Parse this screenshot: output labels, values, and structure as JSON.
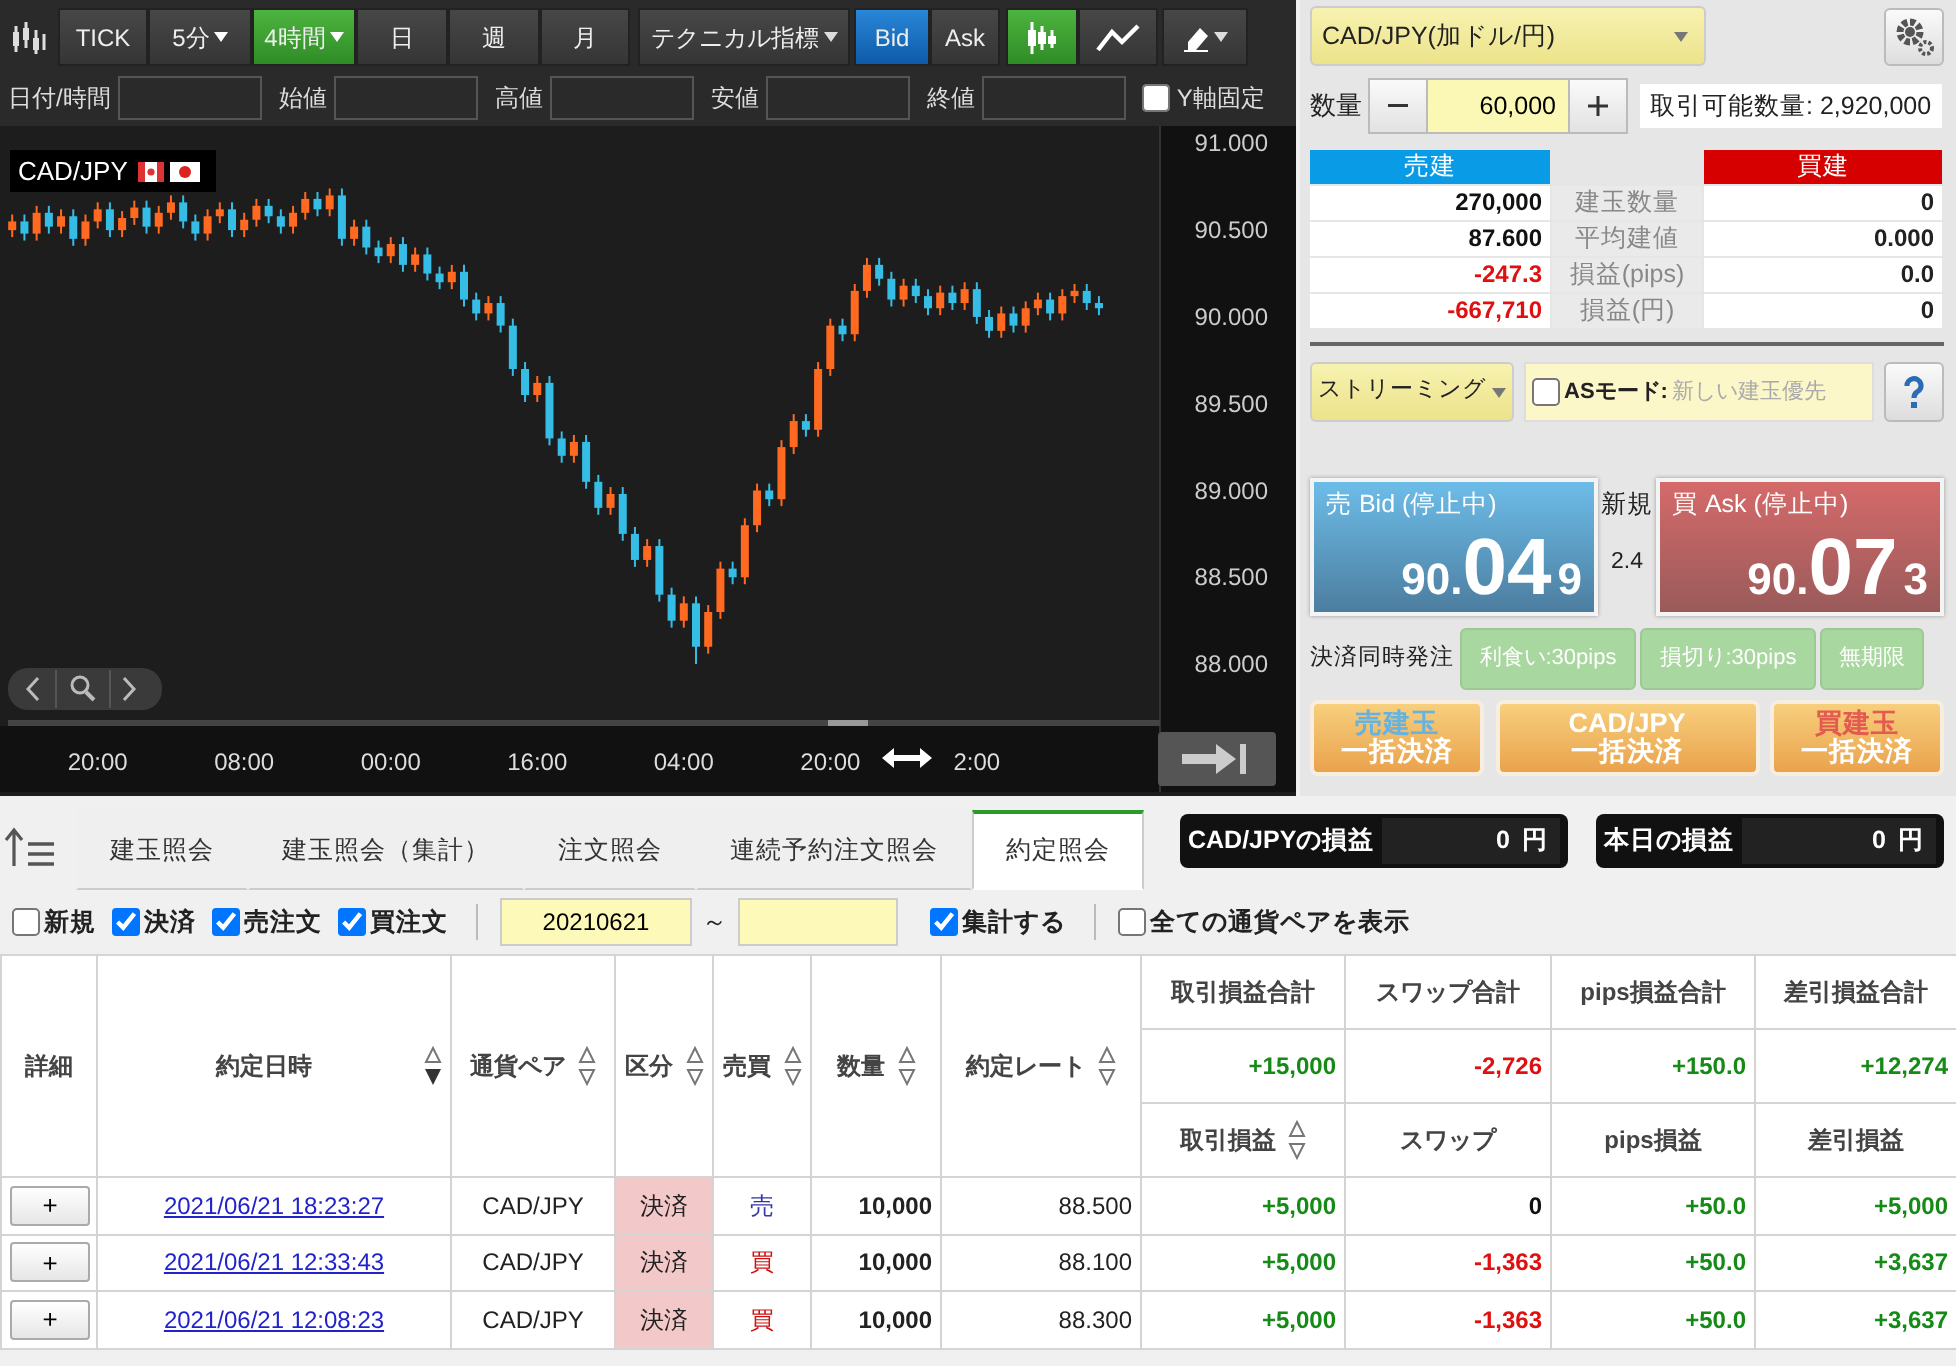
{
  "chart_toolbar": {
    "timeframes": [
      {
        "label": "TICK",
        "dropdown": false,
        "selected": false
      },
      {
        "label": "5分",
        "dropdown": true,
        "selected": false
      },
      {
        "label": "4時間",
        "dropdown": true,
        "selected": true
      },
      {
        "label": "日",
        "dropdown": false,
        "selected": false
      },
      {
        "label": "週",
        "dropdown": false,
        "selected": false
      },
      {
        "label": "月",
        "dropdown": false,
        "selected": false
      }
    ],
    "indicator_menu": "テクニカル指標",
    "price_sides": [
      {
        "label": "Bid",
        "selected": true
      },
      {
        "label": "Ask",
        "selected": false
      }
    ],
    "chart_types": [
      {
        "kind": "candle",
        "selected": true
      },
      {
        "kind": "line",
        "selected": false
      }
    ]
  },
  "ohlc_fields": [
    {
      "label": "日付/時間"
    },
    {
      "label": "始値"
    },
    {
      "label": "高値"
    },
    {
      "label": "安値"
    },
    {
      "label": "終値"
    }
  ],
  "y_axis_lock": {
    "label": "Y軸固定",
    "checked": false
  },
  "chart": {
    "symbol": "CAD/JPY",
    "chart_data": {
      "type": "candlestick",
      "ylim": [
        87.24,
        91.1
      ],
      "yticks": [
        {
          "value": 91,
          "label": "91.000"
        },
        {
          "value": 90.5,
          "label": "90.500"
        },
        {
          "value": 90,
          "label": "90.000"
        },
        {
          "value": 89.5,
          "label": "89.500"
        },
        {
          "value": 89,
          "label": "89.000"
        },
        {
          "value": 88.5,
          "label": "88.500"
        },
        {
          "value": 88,
          "label": "88.000"
        }
      ],
      "categories": [
        null,
        null,
        null,
        null,
        null,
        null,
        null,
        "20:00",
        null,
        null,
        null,
        null,
        null,
        null,
        null,
        null,
        null,
        null,
        null,
        "08:00",
        null,
        null,
        null,
        null,
        null,
        null,
        null,
        null,
        null,
        null,
        null,
        "00:00",
        null,
        null,
        null,
        null,
        null,
        null,
        null,
        null,
        null,
        null,
        null,
        "16:00",
        null,
        null,
        null,
        null,
        null,
        null,
        null,
        null,
        null,
        null,
        null,
        "04:00",
        null,
        null,
        null,
        null,
        null,
        null,
        null,
        null,
        null,
        null,
        null,
        "20:00",
        null,
        null,
        null,
        null,
        null,
        null,
        null,
        null,
        null,
        null,
        null,
        "2:00",
        null,
        null,
        null,
        null,
        null,
        null,
        null,
        null,
        null,
        null
      ],
      "ohlc": [
        [
          90.5,
          90.59,
          90.46,
          90.55
        ],
        [
          90.55,
          90.59,
          90.44,
          90.48
        ],
        [
          90.48,
          90.64,
          90.44,
          90.6
        ],
        [
          90.6,
          90.64,
          90.48,
          90.52
        ],
        [
          90.52,
          90.62,
          90.48,
          90.58
        ],
        [
          90.58,
          90.62,
          90.41,
          90.45
        ],
        [
          90.45,
          90.59,
          90.41,
          90.55
        ],
        [
          90.55,
          90.66,
          90.51,
          90.62
        ],
        [
          90.62,
          90.66,
          90.46,
          90.5
        ],
        [
          90.5,
          90.61,
          90.46,
          90.57
        ],
        [
          90.57,
          90.67,
          90.53,
          90.63
        ],
        [
          90.63,
          90.67,
          90.48,
          90.52
        ],
        [
          90.52,
          90.64,
          90.48,
          90.6
        ],
        [
          90.6,
          90.7,
          90.56,
          90.66
        ],
        [
          90.66,
          90.7,
          90.51,
          90.55
        ],
        [
          90.55,
          90.59,
          90.44,
          90.48
        ],
        [
          90.48,
          90.62,
          90.44,
          90.58
        ],
        [
          90.58,
          90.66,
          90.54,
          90.62
        ],
        [
          90.62,
          90.66,
          90.46,
          90.5
        ],
        [
          90.5,
          90.6,
          90.46,
          90.56
        ],
        [
          90.56,
          90.68,
          90.52,
          90.64
        ],
        [
          90.64,
          90.68,
          90.54,
          90.58
        ],
        [
          90.58,
          90.62,
          90.48,
          90.52
        ],
        [
          90.52,
          90.64,
          90.48,
          90.6
        ],
        [
          90.6,
          90.72,
          90.56,
          90.68
        ],
        [
          90.68,
          90.72,
          90.58,
          90.62
        ],
        [
          90.62,
          90.74,
          90.58,
          90.7
        ],
        [
          90.7,
          90.74,
          90.41,
          90.45
        ],
        [
          90.45,
          90.56,
          90.41,
          90.52
        ],
        [
          90.52,
          90.56,
          90.36,
          90.4
        ],
        [
          90.4,
          90.44,
          90.31,
          90.35
        ],
        [
          90.35,
          90.46,
          90.31,
          90.42
        ],
        [
          90.42,
          90.46,
          90.26,
          90.3
        ],
        [
          90.3,
          90.4,
          90.26,
          90.36
        ],
        [
          90.36,
          90.4,
          90.21,
          90.25
        ],
        [
          90.25,
          90.29,
          90.16,
          90.2
        ],
        [
          90.2,
          90.3,
          90.16,
          90.26
        ],
        [
          90.26,
          90.3,
          90.06,
          90.1
        ],
        [
          90.1,
          90.14,
          89.98,
          90.02
        ],
        [
          90.02,
          90.12,
          89.98,
          90.08
        ],
        [
          90.08,
          90.12,
          89.91,
          89.95
        ],
        [
          89.95,
          89.99,
          89.66,
          89.7
        ],
        [
          89.7,
          89.74,
          89.51,
          89.55
        ],
        [
          89.55,
          89.66,
          89.51,
          89.62
        ],
        [
          89.62,
          89.66,
          89.26,
          89.3
        ],
        [
          89.3,
          89.34,
          89.16,
          89.2
        ],
        [
          89.2,
          89.32,
          89.16,
          89.28
        ],
        [
          89.28,
          89.32,
          89.01,
          89.05
        ],
        [
          89.05,
          89.09,
          88.86,
          88.9
        ],
        [
          88.9,
          89.02,
          88.86,
          88.98
        ],
        [
          88.98,
          89.02,
          88.71,
          88.75
        ],
        [
          88.75,
          88.79,
          88.56,
          88.6
        ],
        [
          88.6,
          88.72,
          88.56,
          88.68
        ],
        [
          88.68,
          88.72,
          88.36,
          88.4
        ],
        [
          88.4,
          88.44,
          88.21,
          88.25
        ],
        [
          88.25,
          88.39,
          88.21,
          88.35
        ],
        [
          88.35,
          88.39,
          88.0,
          88.1
        ],
        [
          88.1,
          88.34,
          88.06,
          88.3
        ],
        [
          88.3,
          88.59,
          88.26,
          88.55
        ],
        [
          88.55,
          88.59,
          88.46,
          88.5
        ],
        [
          88.5,
          88.84,
          88.46,
          88.8
        ],
        [
          88.8,
          89.04,
          88.76,
          89.0
        ],
        [
          89.0,
          89.04,
          88.91,
          88.95
        ],
        [
          88.95,
          89.29,
          88.91,
          89.25
        ],
        [
          89.25,
          89.44,
          89.21,
          89.4
        ],
        [
          89.4,
          89.44,
          89.31,
          89.35
        ],
        [
          89.35,
          89.74,
          89.31,
          89.7
        ],
        [
          89.7,
          89.99,
          89.66,
          89.95
        ],
        [
          89.95,
          89.99,
          89.86,
          89.9
        ],
        [
          89.9,
          90.19,
          89.86,
          90.15
        ],
        [
          90.15,
          90.34,
          90.11,
          90.3
        ],
        [
          90.3,
          90.34,
          90.18,
          90.22
        ],
        [
          90.22,
          90.26,
          90.06,
          90.1
        ],
        [
          90.1,
          90.22,
          90.06,
          90.18
        ],
        [
          90.18,
          90.22,
          90.08,
          90.12
        ],
        [
          90.12,
          90.16,
          90.01,
          90.05
        ],
        [
          90.05,
          90.18,
          90.01,
          90.14
        ],
        [
          90.14,
          90.18,
          90.04,
          90.08
        ],
        [
          90.08,
          90.2,
          90.04,
          90.16
        ],
        [
          90.16,
          90.2,
          89.96,
          90.0
        ],
        [
          90.0,
          90.04,
          89.88,
          89.92
        ],
        [
          89.92,
          90.06,
          89.88,
          90.02
        ],
        [
          90.02,
          90.06,
          89.91,
          89.95
        ],
        [
          89.95,
          90.09,
          89.91,
          90.05
        ],
        [
          90.05,
          90.14,
          90.01,
          90.1
        ],
        [
          90.1,
          90.14,
          89.98,
          90.02
        ],
        [
          90.02,
          90.16,
          89.98,
          90.12
        ],
        [
          90.12,
          90.19,
          90.08,
          90.15
        ],
        [
          90.15,
          90.19,
          90.04,
          90.08
        ],
        [
          90.08,
          90.12,
          90.01,
          90.05
        ]
      ]
    }
  },
  "order_panel": {
    "pair_select": "CAD/JPY(加ドル/円)",
    "quantity_label": "数量",
    "quantity": "60,000",
    "available": "取引可能数量: 2,920,000",
    "positions": {
      "sell_header": "売建",
      "buy_header": "買建",
      "rows": [
        {
          "label": "建玉数量",
          "sell": "270,000",
          "color": "#111111",
          "buy": "0"
        },
        {
          "label": "平均建値",
          "sell": "87.600",
          "color": "#111111",
          "buy": "0.000"
        },
        {
          "label": "損益(pips)",
          "sell": "-247.3",
          "color": "#e01010",
          "buy": "0.0"
        },
        {
          "label": "損益(円)",
          "sell": "-667,710",
          "color": "#e01010",
          "buy": "0"
        }
      ]
    },
    "price_mode": "ストリーミング",
    "as_mode": {
      "label": "ASモード:",
      "value": "新しい建玉優先",
      "checked": false
    },
    "quotes": [
      {
        "kind": "bid",
        "title": "売 Bid (停止中)",
        "big_figure": "90.",
        "pips": "04",
        "fraction": "9"
      },
      {
        "kind": "ask",
        "title": "買 Ask (停止中)",
        "big_figure": "90.",
        "pips": "07",
        "fraction": "3"
      }
    ],
    "spread_label": "新規",
    "spread": "2.4",
    "settle_label": "決済同時発注",
    "settle_options": [
      "利食い:30pips",
      "損切り:30pips",
      "無期限"
    ],
    "bulk_buttons": [
      {
        "kind": "sell",
        "lines": [
          "売建玉",
          "一括決済"
        ]
      },
      {
        "kind": "pair",
        "lines": [
          "CAD/JPY",
          "一括決済"
        ]
      },
      {
        "kind": "buy",
        "lines": [
          "買建玉",
          "一括決済"
        ]
      }
    ]
  },
  "bottom_tabs": [
    {
      "label": "建玉照会",
      "selected": false
    },
    {
      "label": "建玉照会（集計）",
      "selected": false
    },
    {
      "label": "注文照会",
      "selected": false
    },
    {
      "label": "連続予約注文照会",
      "selected": false
    },
    {
      "label": "約定照会",
      "selected": true
    }
  ],
  "pnl_boxes": [
    {
      "label": "CAD/JPYの損益",
      "value": "0",
      "unit": "円"
    },
    {
      "label": "本日の損益",
      "value": "0",
      "unit": "円"
    }
  ],
  "filters": [
    {
      "label": "新規",
      "checked": false
    },
    {
      "label": "決済",
      "checked": true
    },
    {
      "label": "売注文",
      "checked": true
    },
    {
      "label": "買注文",
      "checked": true
    }
  ],
  "date_from": "20210621",
  "date_separator": "～",
  "aggregate": {
    "label": "集計する",
    "checked": true
  },
  "show_all_pairs": {
    "label": "全ての通貨ペアを表示",
    "checked": false
  },
  "table": {
    "columns": [
      {
        "label": "詳細",
        "sortable": false
      },
      {
        "label": "約定日時",
        "sortable": true,
        "sorted_desc": true
      },
      {
        "label": "通貨ペア",
        "sortable": true,
        "sorted_desc": false
      },
      {
        "label": "区分",
        "sortable": true,
        "sorted_desc": false
      },
      {
        "label": "売買",
        "sortable": true,
        "sorted_desc": false
      },
      {
        "label": "数量",
        "sortable": true,
        "sorted_desc": false
      },
      {
        "label": "約定レート",
        "sortable": true,
        "sorted_desc": false
      }
    ],
    "total_headers": [
      "取引損益合計",
      "スワップ合計",
      "pips損益合計",
      "差引損益合計"
    ],
    "totals": [
      {
        "value": "+15,000",
        "color": "#168a16"
      },
      {
        "value": "-2,726",
        "color": "#e01010"
      },
      {
        "value": "+150.0",
        "color": "#168a16"
      },
      {
        "value": "+12,274",
        "color": "#168a16"
      }
    ],
    "sub_columns": [
      {
        "label": "取引損益",
        "sortable": true,
        "sorted_desc": false
      },
      {
        "label": "スワップ",
        "sortable": false
      },
      {
        "label": "pips損益",
        "sortable": false
      },
      {
        "label": "差引損益",
        "sortable": false
      }
    ],
    "rows": [
      {
        "detail": "+",
        "datetime": "2021/06/21 18:23:27",
        "pair": "CAD/JPY",
        "category": "決済",
        "side": {
          "label": "売",
          "kind": "sell"
        },
        "quantity": "10,000",
        "rate": "88.500",
        "pnl": [
          {
            "value": "+5,000",
            "color": "#168a16"
          },
          {
            "value": "0",
            "color": "#111111"
          },
          {
            "value": "+50.0",
            "color": "#168a16"
          },
          {
            "value": "+5,000",
            "color": "#168a16"
          }
        ]
      },
      {
        "detail": "+",
        "datetime": "2021/06/21 12:33:43",
        "pair": "CAD/JPY",
        "category": "決済",
        "side": {
          "label": "買",
          "kind": "buy"
        },
        "quantity": "10,000",
        "rate": "88.100",
        "pnl": [
          {
            "value": "+5,000",
            "color": "#168a16"
          },
          {
            "value": "-1,363",
            "color": "#e01010"
          },
          {
            "value": "+50.0",
            "color": "#168a16"
          },
          {
            "value": "+3,637",
            "color": "#168a16"
          }
        ]
      },
      {
        "detail": "+",
        "datetime": "2021/06/21 12:08:23",
        "pair": "CAD/JPY",
        "category": "決済",
        "side": {
          "label": "買",
          "kind": "buy"
        },
        "quantity": "10,000",
        "rate": "88.300",
        "pnl": [
          {
            "value": "+5,000",
            "color": "#168a16"
          },
          {
            "value": "-1,363",
            "color": "#e01010"
          },
          {
            "value": "+50.0",
            "color": "#168a16"
          },
          {
            "value": "+3,637",
            "color": "#168a16"
          }
        ]
      }
    ]
  }
}
